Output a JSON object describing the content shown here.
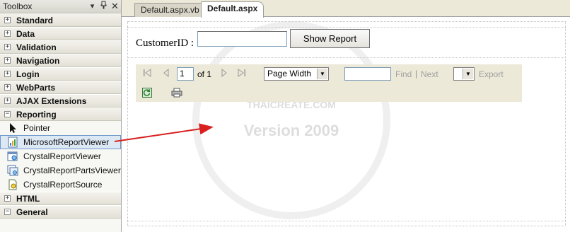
{
  "toolbox": {
    "title": "Toolbox",
    "categories_top": [
      {
        "label": "Standard"
      },
      {
        "label": "Data"
      },
      {
        "label": "Validation"
      },
      {
        "label": "Navigation"
      },
      {
        "label": "Login"
      },
      {
        "label": "WebParts"
      },
      {
        "label": "AJAX Extensions"
      }
    ],
    "reporting": {
      "label": "Reporting",
      "items": [
        {
          "label": "Pointer",
          "icon": "pointer-icon"
        },
        {
          "label": "MicrosoftReportViewer",
          "icon": "report-viewer-icon",
          "selected": true
        },
        {
          "label": "CrystalReportViewer",
          "icon": "crystal-report-viewer-icon"
        },
        {
          "label": "CrystalReportPartsViewer",
          "icon": "crystal-report-parts-viewer-icon"
        },
        {
          "label": "CrystalReportSource",
          "icon": "crystal-report-source-icon"
        }
      ]
    },
    "categories_bottom": [
      {
        "label": "HTML"
      },
      {
        "label": "General"
      }
    ]
  },
  "tabs": [
    {
      "label": "Default.aspx.vb",
      "active": false
    },
    {
      "label": "Default.aspx",
      "active": true
    }
  ],
  "form": {
    "customer_label": "CustomerID :",
    "customer_value": "",
    "button_label": "Show Report"
  },
  "report_viewer": {
    "page_value": "1",
    "of_text": "of 1",
    "zoom_value": "Page Width",
    "find_label": "Find",
    "separator": "|",
    "next_label": "Next",
    "export_label": "Export"
  },
  "watermark": {
    "line1": "THAICREATE.COM",
    "line2": "Version 2009"
  },
  "colors": {
    "toolbar_bg": "#ece9d8",
    "selection_bg": "#dde8f5",
    "arrow": "#d8201f"
  }
}
